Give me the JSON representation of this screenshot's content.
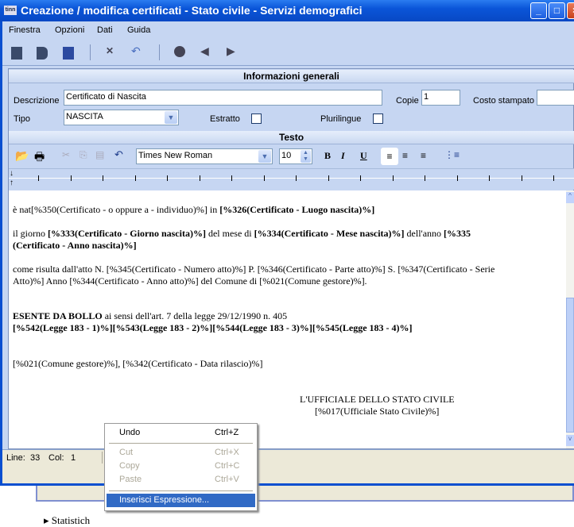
{
  "window": {
    "title": "Creazione / modifica certificati - Stato civile - Servizi demografici",
    "app_icon": "tinn",
    "controls": [
      "minimize",
      "maximize",
      "close"
    ]
  },
  "menu": [
    "Finestra",
    "Opzioni",
    "Dati",
    "Guida"
  ],
  "toolbar_icons": [
    "new-document-icon",
    "open-document-icon",
    "save-icon",
    "delete-icon",
    "undo-icon",
    "search-icon",
    "arrow-left-icon",
    "arrow-right-icon"
  ],
  "general": {
    "header": "Informazioni generali",
    "descrizione_label": "Descrizione",
    "descrizione_value": "Certificato di Nascita",
    "copie_label": "Copie",
    "copie_value": "1",
    "costo_label": "Costo stampato",
    "costo_value": "",
    "tipo_label": "Tipo",
    "tipo_value": "NASCITA",
    "estratto_label": "Estratto",
    "estratto_checked": false,
    "plurilingue_label": "Plurilingue",
    "plurilingue_checked": false
  },
  "text_section": {
    "header": "Testo",
    "font": "Times New Roman",
    "size": "10"
  },
  "editor_lines": [
    [
      {
        "t": "è nat[%350(Certificato - o oppure a - individuo)%] in  ",
        "b": false
      },
      {
        "t": "[%326(Certificato - Luogo nascita)%]",
        "b": true
      }
    ],
    [
      {
        "t": "il giorno ",
        "b": false
      },
      {
        "t": "[%333(Certificato - Giorno nascita)%]",
        "b": true
      },
      {
        "t": " del mese di ",
        "b": false
      },
      {
        "t": "[%334(Certificato - Mese nascita)%]",
        "b": true
      },
      {
        "t": " dell'anno ",
        "b": false
      },
      {
        "t": "[%335",
        "b": true
      }
    ],
    [
      {
        "t": "(Certificato - Anno nascita)%]",
        "b": true
      }
    ],
    [
      {
        "t": "come risulta dall'atto N. [%345(Certificato - Numero atto)%]  P. [%346(Certificato - Parte atto)%]  S. [%347(Certificato - Serie",
        "b": false
      }
    ],
    [
      {
        "t": "Atto)%]  Anno [%344(Certificato - Anno atto)%]  del Comune di [%021(Comune gestore)%].",
        "b": false
      }
    ],
    [
      {
        "t": "ESENTE DA BOLLO",
        "b": true
      },
      {
        "t": " ai sensi dell'art. 7 della legge 29/12/1990 n. 405",
        "b": false
      }
    ],
    [
      {
        "t": "[%542(Legge 183 - 1)%][%543(Legge 183 - 2)%][%544(Legge 183 - 3)%][%545(Legge 183 - 4)%]",
        "b": true
      }
    ],
    [
      {
        "t": "[%021(Comune gestore)%],   [%342(Certificato - Data rilascio)%]",
        "b": false
      }
    ],
    [
      {
        "t": "L'UFFICIALE DELLO STATO CIVILE",
        "b": false
      }
    ],
    [
      {
        "t": "[%017(Ufficiale Stato Civile)%]",
        "b": false
      }
    ]
  ],
  "status": {
    "line_label": "Line:",
    "line": "33",
    "col_label": "Col:",
    "col": "1"
  },
  "context_menu": [
    {
      "label": "Undo",
      "shortcut": "Ctrl+Z",
      "enabled": true
    },
    {
      "label": "Cut",
      "shortcut": "Ctrl+X",
      "enabled": false
    },
    {
      "label": "Copy",
      "shortcut": "Ctrl+C",
      "enabled": false
    },
    {
      "label": "Paste",
      "shortcut": "Ctrl+V",
      "enabled": false
    },
    {
      "label": "Inserisci Espressione...",
      "shortcut": "",
      "enabled": true,
      "highlighted": true
    }
  ],
  "background_text": "Statistich"
}
